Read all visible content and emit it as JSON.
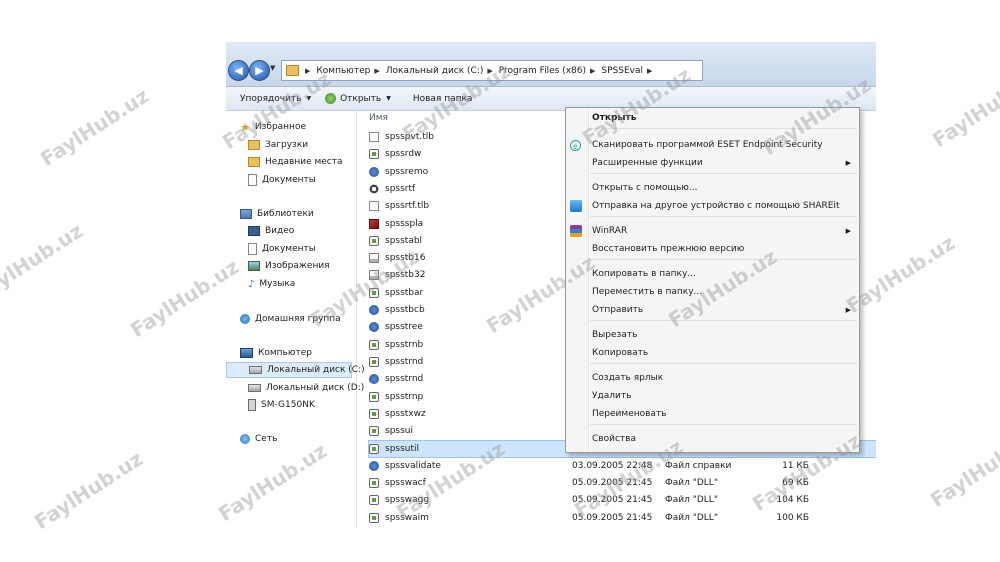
{
  "explorer": {
    "breadcrumbs": [
      "Компьютер",
      "Локальный диск (C:)",
      "Program Files (x86)",
      "SPSSEval"
    ],
    "toolbar": {
      "organize": "Упорядочить",
      "open": "Открыть",
      "new_folder": "Новая папка"
    },
    "nav": {
      "favorites": "Избранное",
      "downloads": "Загрузки",
      "recent": "Недавние места",
      "documents": "Документы",
      "libraries": "Библиотеки",
      "video": "Видео",
      "lib_documents": "Документы",
      "images": "Изображения",
      "music": "Музыка",
      "homegroup": "Домашняя группа",
      "computer": "Компьютер",
      "drive_c": "Локальный диск (C:)",
      "drive_d": "Локальный диск (D:)",
      "device": "SM-G150NK",
      "network": "Сеть"
    },
    "column_name": "Имя",
    "files": [
      {
        "name": "spsspvt.tlb",
        "date": "",
        "type": "",
        "size": ""
      },
      {
        "name": "spssrdw",
        "date": "",
        "type": "",
        "size": ""
      },
      {
        "name": "spssremo",
        "date": "",
        "type": "",
        "size": ""
      },
      {
        "name": "spssrtf",
        "date": "",
        "type": "",
        "size": ""
      },
      {
        "name": "spssrtf.tlb",
        "date": "",
        "type": "",
        "size": ""
      },
      {
        "name": "spssspla",
        "date": "",
        "type": "",
        "size": ""
      },
      {
        "name": "spsstabl",
        "date": "",
        "type": "",
        "size": ""
      },
      {
        "name": "spsstb16",
        "date": "",
        "type": "",
        "size": ""
      },
      {
        "name": "spsstb32",
        "date": "",
        "type": "",
        "size": ""
      },
      {
        "name": "spsstbar",
        "date": "",
        "type": "",
        "size": ""
      },
      {
        "name": "spsstbcb",
        "date": "",
        "type": "",
        "size": ""
      },
      {
        "name": "spsstree",
        "date": "",
        "type": "",
        "size": ""
      },
      {
        "name": "spsstrnb",
        "date": "",
        "type": "",
        "size": ""
      },
      {
        "name": "spsstrnd",
        "date": "",
        "type": "",
        "size": ""
      },
      {
        "name": "spsstrnd",
        "date": "",
        "type": "",
        "size": ""
      },
      {
        "name": "spsstrnp",
        "date": "",
        "type": "",
        "size": ""
      },
      {
        "name": "spsstxwz",
        "date": "",
        "type": "",
        "size": ""
      },
      {
        "name": "spssui",
        "date": "",
        "type": "",
        "size": ""
      },
      {
        "name": "spssutil",
        "date": "",
        "type": "",
        "size": ""
      },
      {
        "name": "spssvalidate",
        "date": "03.09.2005 22:48",
        "type": "Файл справки",
        "size": "11 КБ"
      },
      {
        "name": "spsswacf",
        "date": "05.09.2005 21:45",
        "type": "Файл \"DLL\"",
        "size": "69 КБ"
      },
      {
        "name": "spsswagg",
        "date": "05.09.2005 21:45",
        "type": "Файл \"DLL\"",
        "size": "104 КБ"
      },
      {
        "name": "spsswaim",
        "date": "05.09.2005 21:45",
        "type": "Файл \"DLL\"",
        "size": "100 КБ"
      }
    ]
  },
  "context_menu": {
    "open": "Открыть",
    "eset": "Сканировать программой ESET Endpoint Security",
    "extended": "Расширенные функции",
    "open_with": "Открыть с помощью...",
    "shareit": "Отправка на другое устройство с помощью SHAREit",
    "winrar": "WinRAR",
    "restore": "Восстановить прежнюю версию",
    "copy_to": "Копировать в папку...",
    "move_to": "Переместить в папку...",
    "send_to": "Отправить",
    "cut": "Вырезать",
    "copy": "Копировать",
    "create_shortcut": "Создать ярлык",
    "delete": "Удалить",
    "rename": "Переименовать",
    "properties": "Свойства"
  },
  "watermark": "FaylHub.uz"
}
